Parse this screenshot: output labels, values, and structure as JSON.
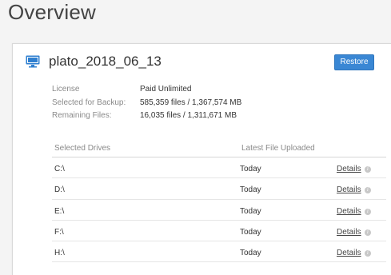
{
  "page": {
    "title": "Overview"
  },
  "device": {
    "icon": "monitor-icon",
    "name": "plato_2018_06_13",
    "restore_label": "Restore"
  },
  "info": [
    {
      "label": "License",
      "value": "Paid Unlimited"
    },
    {
      "label": "Selected for Backup:",
      "value": "585,359 files / 1,367,574 MB"
    },
    {
      "label": "Remaining Files:",
      "value": "16,035 files / 1,311,671 MB"
    }
  ],
  "drives": {
    "headers": {
      "drive": "Selected Drives",
      "latest": "Latest File Uploaded"
    },
    "rows": [
      {
        "drive": "C:\\",
        "latest": "Today",
        "details": "Details"
      },
      {
        "drive": "D:\\",
        "latest": "Today",
        "details": "Details"
      },
      {
        "drive": "E:\\",
        "latest": "Today",
        "details": "Details"
      },
      {
        "drive": "F:\\",
        "latest": "Today",
        "details": "Details"
      },
      {
        "drive": "H:\\",
        "latest": "Today",
        "details": "Details"
      }
    ]
  },
  "colors": {
    "accent": "#3a87d4",
    "icon": "#2f7fd0"
  }
}
